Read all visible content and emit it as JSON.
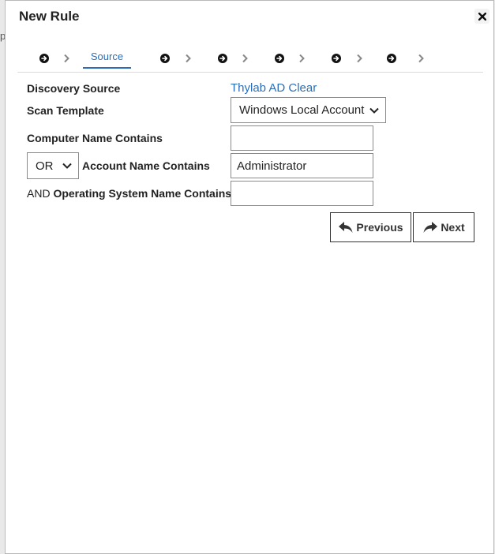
{
  "background": {
    "edge_text": "p"
  },
  "dialog": {
    "title": "New Rule",
    "close_icon": "close-icon",
    "steps": {
      "active_label": "Source",
      "count": 7
    }
  },
  "form": {
    "discovery_source_label": "Discovery Source",
    "discovery_source_value": "Thylab AD Clear",
    "scan_template_label": "Scan Template",
    "scan_template_value": "Windows Local Account",
    "computer_name_label": "Computer Name Contains",
    "computer_name_value": "",
    "logic_operator_value": "OR",
    "account_name_label": "Account Name Contains",
    "account_name_value": "Administrator",
    "os_prefix": "AND",
    "os_label": "Operating System Name Contains",
    "os_value": ""
  },
  "buttons": {
    "previous": "Previous",
    "next": "Next"
  },
  "colors": {
    "accent": "#2a6ebb",
    "text": "#222222"
  }
}
